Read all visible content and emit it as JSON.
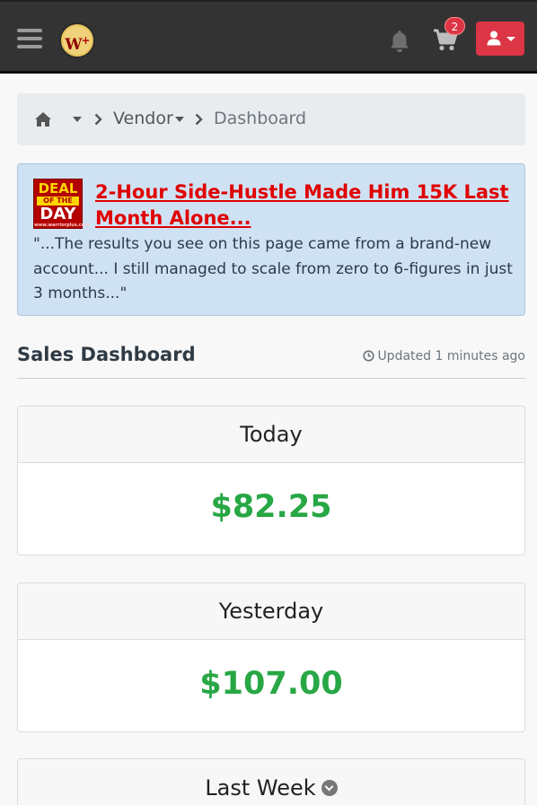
{
  "navbar": {
    "logo_text": "W",
    "logo_plus": "+",
    "cart_count": "2"
  },
  "breadcrumb": {
    "vendor": "Vendor",
    "current": "Dashboard"
  },
  "deal": {
    "badge_line1": "DEAL",
    "badge_line2": "OF THE",
    "badge_line3": "DAY",
    "badge_line4": "www.warriorplus.com",
    "title": "2-Hour Side-Hustle Made Him 15K Last Month Alone...",
    "quote": "\"...The results you see on this page came from a brand-new account... I still managed to scale from zero to 6-figures in just 3 months...\""
  },
  "sales": {
    "title": "Sales Dashboard",
    "updated": "Updated 1 minutes ago"
  },
  "cards": [
    {
      "label": "Today",
      "value": "$82.25"
    },
    {
      "label": "Yesterday",
      "value": "$107.00"
    },
    {
      "label": "Last Week"
    }
  ],
  "colors": {
    "navbar": "#333333",
    "accent_red": "#dc3545",
    "money_green": "#28a745",
    "deal_bg": "#cfe2f3",
    "deal_title": "#e00000"
  }
}
